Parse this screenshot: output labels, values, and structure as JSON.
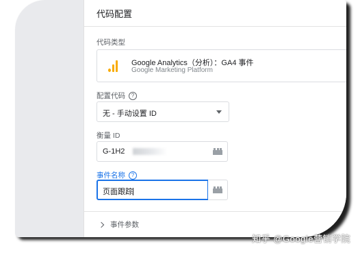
{
  "card": {
    "title": "代码配置"
  },
  "tag_type": {
    "label": "代码类型",
    "name": "Google Analytics（分析）：GA4 事件",
    "platform": "Google Marketing Platform",
    "icon": "google-analytics-icon",
    "accent": "#f9ab00"
  },
  "config_tag": {
    "label": "配置代码",
    "help_icon": "?",
    "value": "无 - 手动设置 ID"
  },
  "measurement_id": {
    "label": "衡量 ID",
    "value": "G-1H2"
  },
  "event_name": {
    "label": "事件名称",
    "help_icon": "?",
    "value": "页面跟踪"
  },
  "event_params": {
    "label": "事件参数"
  },
  "watermark": {
    "text": "知乎 @Google营销学院"
  },
  "colors": {
    "focus_blue": "#1a73e8",
    "border": "#dadce0"
  }
}
